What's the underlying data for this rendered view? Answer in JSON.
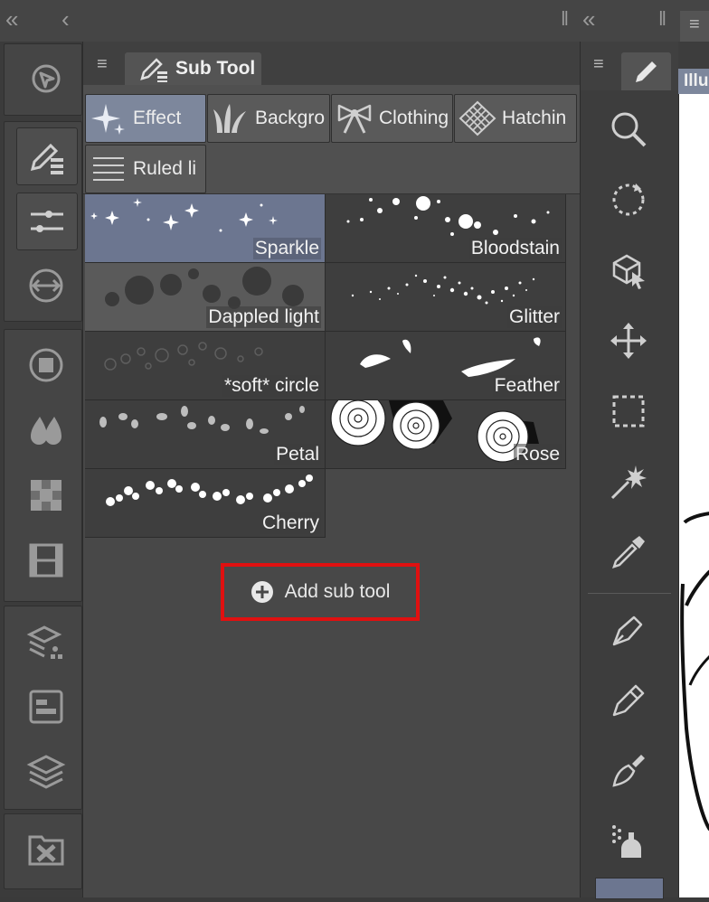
{
  "topbar": {
    "collapse_glyph": "«",
    "back_glyph": "‹",
    "grip_glyph": "‖",
    "right_collapse_glyph": "«"
  },
  "left_toolbar": {
    "icons": [
      "navigator-icon",
      "sub-tool-icon",
      "tool-property-icon",
      "color-swap-icon",
      "color-circle-icon",
      "color-set-icon",
      "mixing-icon",
      "timeline-icon",
      "layer-property-icon",
      "layer-search-icon",
      "layer-icon",
      "material-icon"
    ]
  },
  "sub_tool_panel": {
    "menu_glyph": "≡",
    "tab_label": "Sub Tool",
    "groups": [
      {
        "label": "Effect",
        "icon": "sparkle-icon",
        "selected": true
      },
      {
        "label": "Backgro",
        "icon": "grass-icon",
        "selected": false
      },
      {
        "label": "Clothing",
        "icon": "ribbon-icon",
        "selected": false
      },
      {
        "label": "Hatchin",
        "icon": "hatching-icon",
        "selected": false
      },
      {
        "label": "Ruled li",
        "icon": "ruled-line-icon",
        "selected": false
      }
    ],
    "items": [
      {
        "label": "Sparkle",
        "selected": true
      },
      {
        "label": "Bloodstain",
        "selected": false
      },
      {
        "label": "Dappled light",
        "selected": false
      },
      {
        "label": "Glitter",
        "selected": false
      },
      {
        "label": "*soft* circle",
        "selected": false
      },
      {
        "label": "Feather",
        "selected": false
      },
      {
        "label": "Petal",
        "selected": false
      },
      {
        "label": "Rose",
        "selected": false
      },
      {
        "label": "Cherry",
        "selected": false
      }
    ],
    "add_button_label": "Add sub tool"
  },
  "tool_palette": {
    "menu_glyph": "≡",
    "tools": [
      "zoom-icon",
      "rotate-icon",
      "object-icon",
      "move-icon",
      "selection-icon",
      "auto-select-icon",
      "eyedropper-icon",
      "pen-icon",
      "pencil-icon",
      "brush-icon",
      "airbrush-icon",
      "decoration-icon"
    ]
  },
  "canvas": {
    "tab_label": "Illu"
  },
  "colors": {
    "selected": "#7d879c",
    "highlight_box": "#e01010",
    "panel": "#484848"
  }
}
